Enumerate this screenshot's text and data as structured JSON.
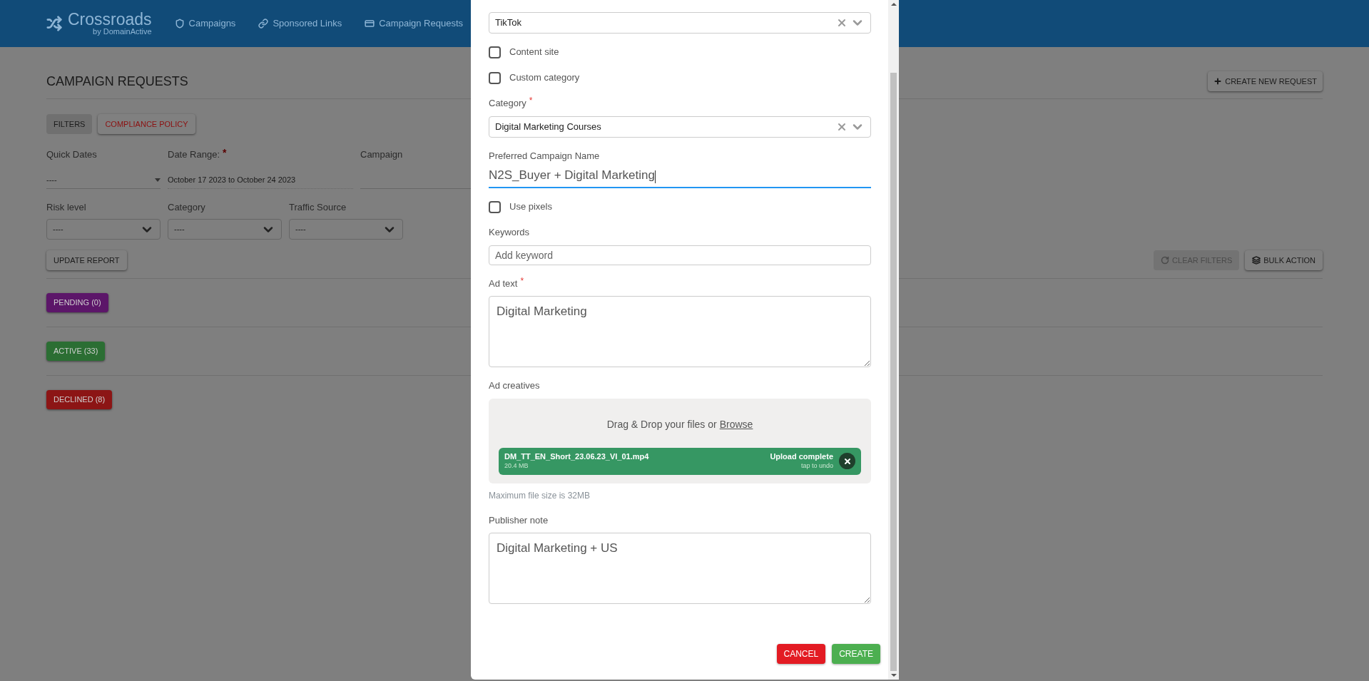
{
  "header": {
    "logo": {
      "name": "Crossroads",
      "tagline": "by DomainActive"
    },
    "nav": [
      {
        "label": "Campaigns"
      },
      {
        "label": "Sponsored Links"
      },
      {
        "label": "Campaign Requests"
      }
    ]
  },
  "page": {
    "title": "CAMPAIGN REQUESTS",
    "create_button": {
      "label": "CREATE NEW REQUEST"
    },
    "tabs": [
      {
        "label": "FILTERS",
        "selected": true
      },
      {
        "label": "COMPLIANCE POLICY",
        "selected": false
      }
    ],
    "date_filters": [
      {
        "kind": "dropdown",
        "label": "Quick Dates",
        "value": "----"
      },
      {
        "kind": "range",
        "label": "Date Range:",
        "required_mark": "*",
        "value": "October 17 2023 to October 24 2023"
      },
      {
        "kind": "text",
        "label": "Campaign"
      }
    ],
    "select_filters": [
      {
        "label": "Risk level",
        "value": "----"
      },
      {
        "label": "Category",
        "value": "----"
      },
      {
        "label": "Traffic Source",
        "value": "----"
      }
    ],
    "update_button": "UPDATE REPORT",
    "clear_filters": {
      "label": "CLEAR FILTERS",
      "disabled": true
    },
    "bulk_action": {
      "label": "BULK ACTION"
    },
    "status_groups": [
      {
        "label": "PENDING (0)",
        "color": "#5c1669"
      },
      {
        "label": "ACTIVE (33)",
        "color": "#2b6e33"
      },
      {
        "label": "DECLINED (8)",
        "color": "#8c1515"
      }
    ]
  },
  "modal": {
    "fields": [
      {
        "kind": "select",
        "value": "TikTok"
      },
      {
        "kind": "checkbox",
        "label": "Content site",
        "checked": false
      },
      {
        "kind": "checkbox",
        "label": "Custom category",
        "checked": false
      },
      {
        "kind": "select",
        "label": "Category",
        "required_mark": "*",
        "value": "Digital Marketing Courses"
      },
      {
        "kind": "input",
        "label": "Preferred Campaign Name",
        "value": "N2S_Buyer + Digital Marketing",
        "focused": true
      },
      {
        "kind": "checkbox",
        "label": "Use pixels",
        "checked": false
      },
      {
        "kind": "keywords",
        "label": "Keywords",
        "placeholder": "Add keyword"
      },
      {
        "kind": "textarea",
        "label": "Ad text",
        "required_mark": "*",
        "value": "Digital Marketing"
      },
      {
        "kind": "upload",
        "label": "Ad creatives",
        "prompt": "Drag & Drop your files or",
        "browse": "Browse",
        "file": {
          "name": "DM_TT_EN_Short_23.06.23_VI_01.mp4",
          "size": "20.4 MB",
          "status": "Upload complete",
          "hint": "tap to undo"
        },
        "note": "Maximum file size is 32MB"
      },
      {
        "kind": "textarea",
        "label": "Publisher note",
        "value": "Digital Marketing + US"
      }
    ],
    "buttons": [
      {
        "label": "CANCEL",
        "kind": "danger"
      },
      {
        "label": "CREATE",
        "kind": "primary"
      }
    ]
  }
}
